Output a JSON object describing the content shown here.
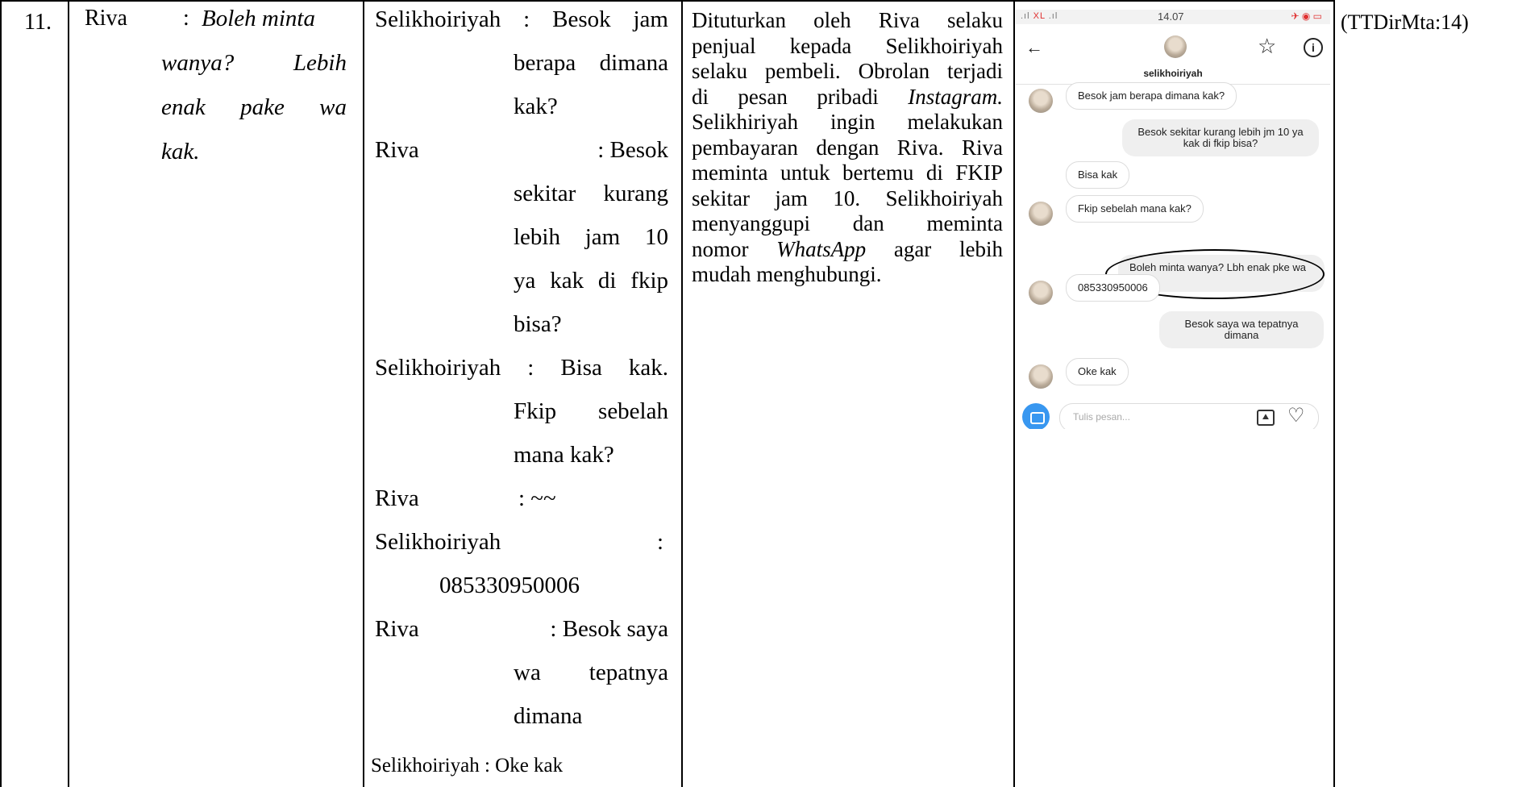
{
  "row": {
    "number": "11.",
    "col1": {
      "speaker": "Riva",
      "colon": ":",
      "lines": [
        "Boleh minta",
        "wanya? Lebih",
        "enak pake wa",
        "kak."
      ]
    },
    "col2": {
      "l1": "Selikhoiriyah : Besok jam",
      "l2": "berapa dimana",
      "l3": "kak?",
      "riva_a": "Riva",
      "riva_a_text": ": Besok",
      "l5": "sekitar kurang",
      "l6": "lebih jam 10",
      "l7": "ya kak di fkip",
      "l8": "bisa?",
      "l9": "Selikhoiriyah : Bisa kak.",
      "l10": "Fkip sebelah",
      "l11": "mana kak?",
      "riva_b": "Riva",
      "riva_b_text": ": ~~",
      "selik": "Selikhoiriyah",
      "selik_colon": ":",
      "phone_no": "085330950006",
      "riva_c": "Riva",
      "riva_c_text": ": Besok saya",
      "l16": "wa tepatnya",
      "l17": "dimana",
      "l18": "Selikhoiriyah : Oke kak"
    },
    "col3": {
      "lines": [
        [
          "Dituturkan",
          "oleh",
          "Riva",
          "selaku"
        ],
        [
          "penjual",
          "kepada",
          "Selikhoiriyah"
        ],
        [
          "selaku",
          "pembeli.",
          "Obrolan",
          "terjadi"
        ],
        [
          "di",
          "pesan",
          "pribadi",
          "Instagram."
        ],
        [
          "Selikhiriyah",
          "ingin",
          "melakukan"
        ],
        [
          "pembayaran",
          "dengan",
          "Riva.",
          "Riva"
        ],
        [
          "meminta",
          "untuk",
          "bertemu",
          "di",
          "FKIP"
        ],
        [
          "sekitar",
          "jam",
          "10.",
          "Selikhoiriyah"
        ],
        [
          "menyanggupi",
          "dan",
          "meminta"
        ],
        [
          "nomor",
          "WhatsApp",
          "agar",
          "lebih"
        ],
        [
          "mudah menghubungi."
        ]
      ]
    },
    "col4": {
      "status_time": "14.07",
      "status_sig": "XL",
      "username": "selikhoiriyah",
      "messages": [
        {
          "from": "in",
          "text": "Besok jam berapa dimana kak?"
        },
        {
          "from": "out",
          "text": "Besok sekitar kurang lebih jm 10 ya kak di fkip bisa?"
        },
        {
          "from": "in",
          "text": "Bisa kak"
        },
        {
          "from": "in",
          "text": "Fkip sebelah mana kak?"
        },
        {
          "from": "out",
          "text": "Boleh minta wanya? Lbh enak pke wa kak"
        },
        {
          "from": "in",
          "text": "085330950006"
        },
        {
          "from": "out",
          "text": "Besok saya wa tepatnya dimana"
        },
        {
          "from": "in",
          "text": "Oke kak"
        }
      ],
      "input_placeholder": "Tulis pesan...",
      "icons": [
        "back-arrow-icon",
        "star-icon",
        "info-icon",
        "camera-icon",
        "image-icon",
        "heart-icon"
      ]
    },
    "col5": {
      "code": "(TTDirMta:14)"
    }
  }
}
